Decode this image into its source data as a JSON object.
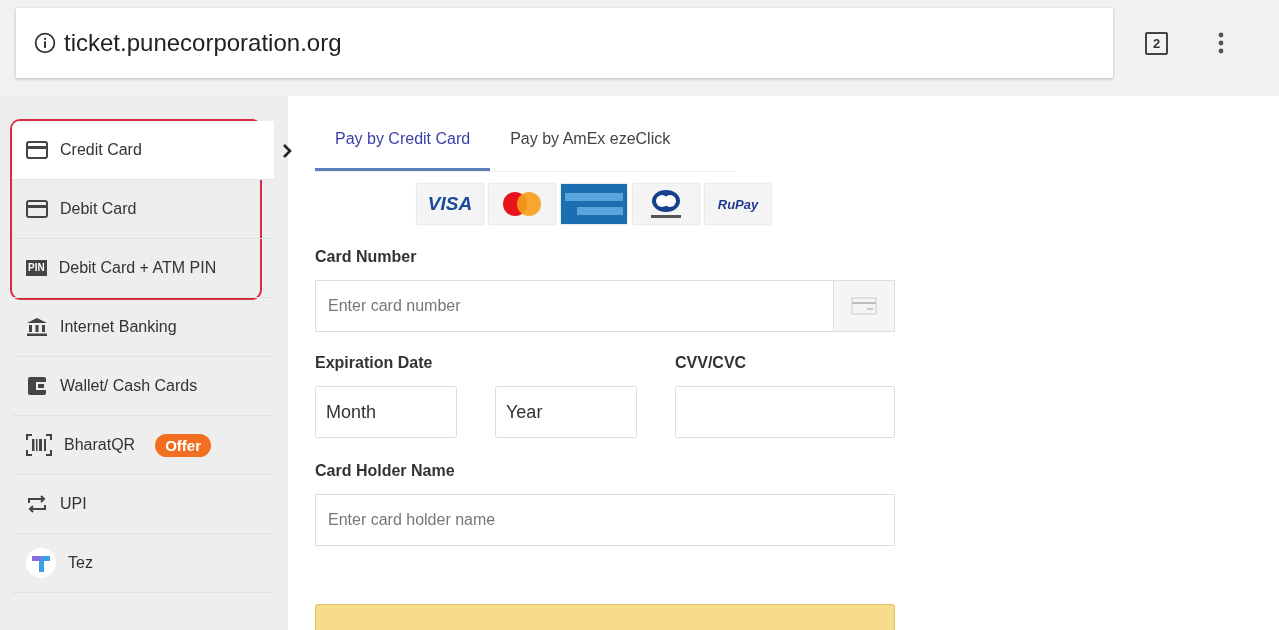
{
  "address_bar": {
    "url": "ticket.punecorporation.org",
    "tab_count": "2"
  },
  "sidebar": {
    "items": [
      {
        "kind": "card",
        "label": "Credit Card",
        "selected": true,
        "highlighted": true
      },
      {
        "kind": "card",
        "label": "Debit Card",
        "selected": false,
        "highlighted": true
      },
      {
        "kind": "pin",
        "label": "Debit Card + ATM PIN",
        "icon_text": "PIN",
        "selected": false,
        "highlighted": true
      },
      {
        "kind": "bank",
        "label": "Internet Banking",
        "selected": false,
        "highlighted": false
      },
      {
        "kind": "wallet",
        "label": "Wallet/ Cash Cards",
        "selected": false,
        "highlighted": false
      },
      {
        "kind": "qr",
        "label": "BharatQR",
        "badge": "Offer",
        "selected": false,
        "highlighted": false
      },
      {
        "kind": "upi",
        "label": "UPI",
        "selected": false,
        "highlighted": false
      },
      {
        "kind": "tez",
        "label": "Tez",
        "selected": false,
        "highlighted": false
      }
    ]
  },
  "tabs": [
    {
      "label": "Pay by Credit Card",
      "selected": true
    },
    {
      "label": "Pay by AmEx ezeClick",
      "selected": false
    }
  ],
  "card_logos": [
    {
      "kind": "visa",
      "text": "VISA"
    },
    {
      "kind": "mastercard"
    },
    {
      "kind": "amex"
    },
    {
      "kind": "diners"
    },
    {
      "kind": "rupay",
      "text": "RuPay"
    }
  ],
  "form": {
    "card_number": {
      "label": "Card Number",
      "placeholder": "Enter card number"
    },
    "expiry": {
      "label": "Expiration Date",
      "month": "Month",
      "year": "Year"
    },
    "cvv": {
      "label": "CVV/CVC"
    },
    "holder": {
      "label": "Card Holder Name",
      "placeholder": "Enter card holder name"
    }
  }
}
